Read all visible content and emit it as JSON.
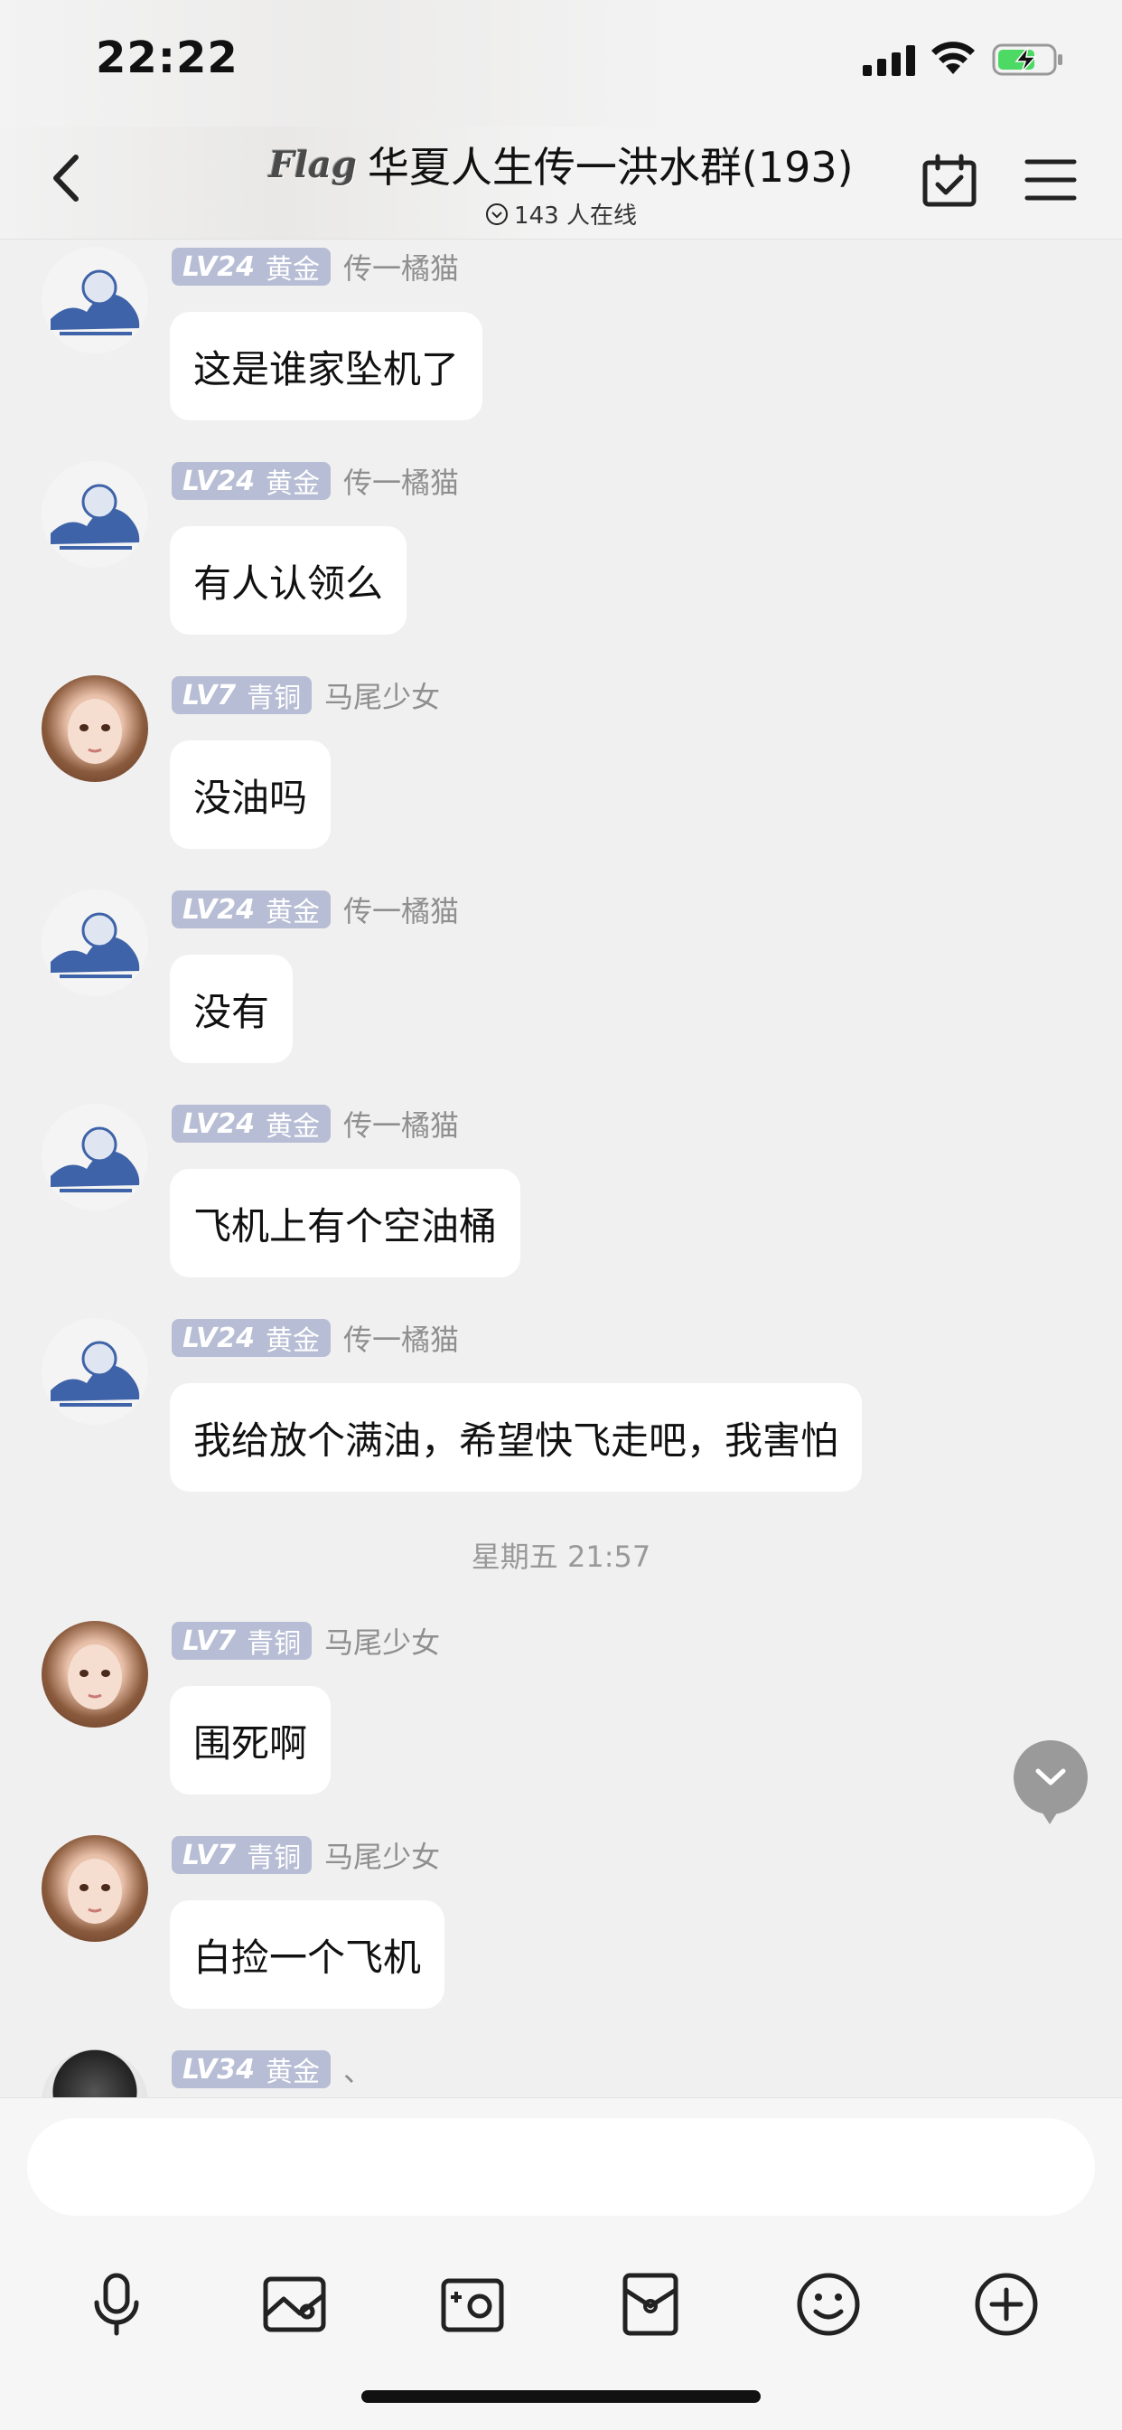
{
  "status_bar": {
    "time": "22:22"
  },
  "header": {
    "logo_text": "Flag",
    "title": "华夏人生传一洪水群(193)",
    "online": "143 人在线"
  },
  "messages": [
    {
      "level": "LV24",
      "rank": "黄金",
      "nickname": "传一橘猫",
      "text": "这是谁家坠机了",
      "avatar": "cat-avatar"
    },
    {
      "level": "LV24",
      "rank": "黄金",
      "nickname": "传一橘猫",
      "text": "有人认领么",
      "avatar": "cat-avatar"
    },
    {
      "level": "LV7",
      "rank": "青铜",
      "nickname": "马尾少女",
      "text": "没油吗",
      "avatar": "girl-avatar"
    },
    {
      "level": "LV24",
      "rank": "黄金",
      "nickname": "传一橘猫",
      "text": "没有",
      "avatar": "cat-avatar"
    },
    {
      "level": "LV24",
      "rank": "黄金",
      "nickname": "传一橘猫",
      "text": "飞机上有个空油桶",
      "avatar": "cat-avatar"
    },
    {
      "level": "LV24",
      "rank": "黄金",
      "nickname": "传一橘猫",
      "text": "我给放个满油，希望快飞走吧，我害怕",
      "avatar": "cat-avatar"
    },
    {
      "level": "LV7",
      "rank": "青铜",
      "nickname": "马尾少女",
      "text": "围死啊",
      "avatar": "girl-avatar"
    },
    {
      "level": "LV7",
      "rank": "青铜",
      "nickname": "马尾少女",
      "text": "白捡一个飞机",
      "avatar": "girl-avatar"
    },
    {
      "level": "LV34",
      "rank": "黄金",
      "nickname": "、",
      "text": "",
      "avatar": "dark-avatar"
    }
  ],
  "time_divider": "星期五 21:57",
  "input": {
    "value": "",
    "placeholder": ""
  },
  "toolbar": [
    "microphone-icon",
    "image-icon",
    "camera-icon",
    "red-packet-icon",
    "emoji-icon",
    "plus-icon"
  ]
}
